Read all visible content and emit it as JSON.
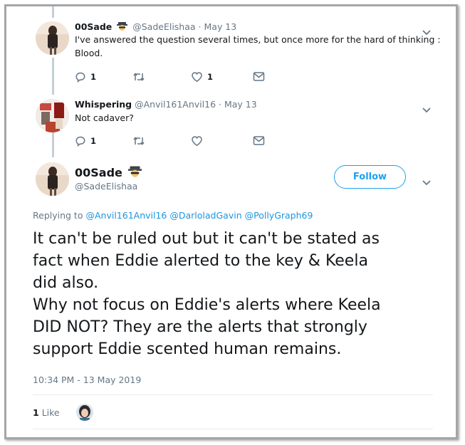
{
  "tweets": [
    {
      "name": "00Sade",
      "handle": "@SadeElishaa",
      "date": "· May 13",
      "text_lines": [
        "I've answered the question several times, but once more for the hard of thinking :",
        "Blood."
      ],
      "reply_count": "1",
      "retweet_count": "",
      "like_count": "1"
    },
    {
      "name": "Whispering",
      "handle": "@Anvil161Anvil16",
      "date": "· May 13",
      "text_lines": [
        "Not cadaver?"
      ],
      "reply_count": "1",
      "retweet_count": "",
      "like_count": ""
    }
  ],
  "main_tweet": {
    "name": "00Sade",
    "handle": "@SadeElishaa",
    "follow_label": "Follow",
    "replying_prefix": "Replying to",
    "mentions": [
      "@Anvil161Anvil16",
      "@DarloladGavin",
      "@PollyGraph69"
    ],
    "text_lines": [
      "It can't be ruled out but it can't be stated as",
      "fact when Eddie alerted to the key & Keela",
      "did also.",
      "Why not focus on Eddie's alerts where Keela",
      "DID NOT? They are the alerts that strongly",
      "support Eddie scented human remains."
    ],
    "timestamp": "10:34 PM - 13 May 2019",
    "like_count": "1",
    "like_label": "Like"
  },
  "icons": {
    "reply": "reply-icon",
    "retweet": "retweet-icon",
    "like": "heart-icon",
    "dm": "message-icon",
    "caret": "chevron-down-icon",
    "emoji": "detective-emoji-icon"
  },
  "colors": {
    "accent": "#1da1f2",
    "link": "#1b95e0",
    "muted": "#657786",
    "thread_line": "#c4cfd6"
  }
}
